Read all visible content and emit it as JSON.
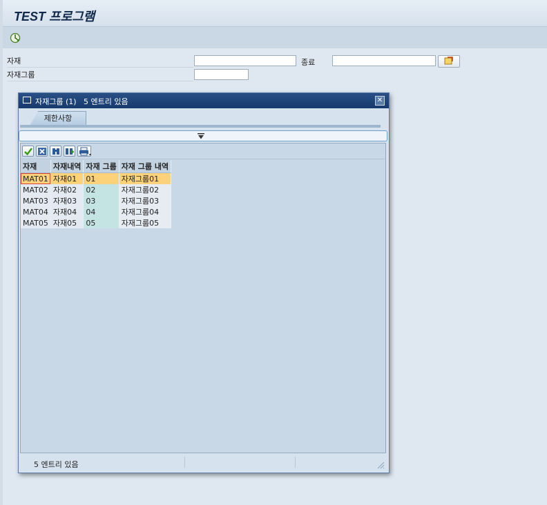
{
  "app": {
    "title": "TEST 프로그램"
  },
  "toolbar": {
    "execute_icon": "execute-icon"
  },
  "selection": {
    "material_label": "자재",
    "material_from": "",
    "to_label": "종료",
    "material_to": "",
    "material_group_label": "자재그룹",
    "material_group_value": "",
    "multiple_selection_icon": "multiple-selection-icon"
  },
  "dialog": {
    "title": "자재그룹 (1)   5 엔트리 있음",
    "tab_label": "제한사항",
    "close_icon": "close-icon",
    "toolbar_icons": [
      "check-icon",
      "cancel-icon",
      "find-icon",
      "find-next-icon",
      "print-icon"
    ],
    "columns": [
      "자재",
      "자재내역",
      "자재 그룹",
      "자재 그룹 내역"
    ],
    "rows": [
      {
        "material": "MAT01",
        "desc": "자재01",
        "group": "01",
        "group_desc": "자재그룹01"
      },
      {
        "material": "MAT02",
        "desc": "자재02",
        "group": "02",
        "group_desc": "자재그룹02"
      },
      {
        "material": "MAT03",
        "desc": "자재03",
        "group": "03",
        "group_desc": "자재그룹03"
      },
      {
        "material": "MAT04",
        "desc": "자재04",
        "group": "04",
        "group_desc": "자재그룹04"
      },
      {
        "material": "MAT05",
        "desc": "자재05",
        "group": "05",
        "group_desc": "자재그룹05"
      }
    ],
    "selected_row": 0,
    "status_text": "5 엔트리 있음"
  },
  "colors": {
    "title_bar": "#1f4478",
    "selected_row": "#fbd27a",
    "group_column": "#c4e4e4"
  }
}
